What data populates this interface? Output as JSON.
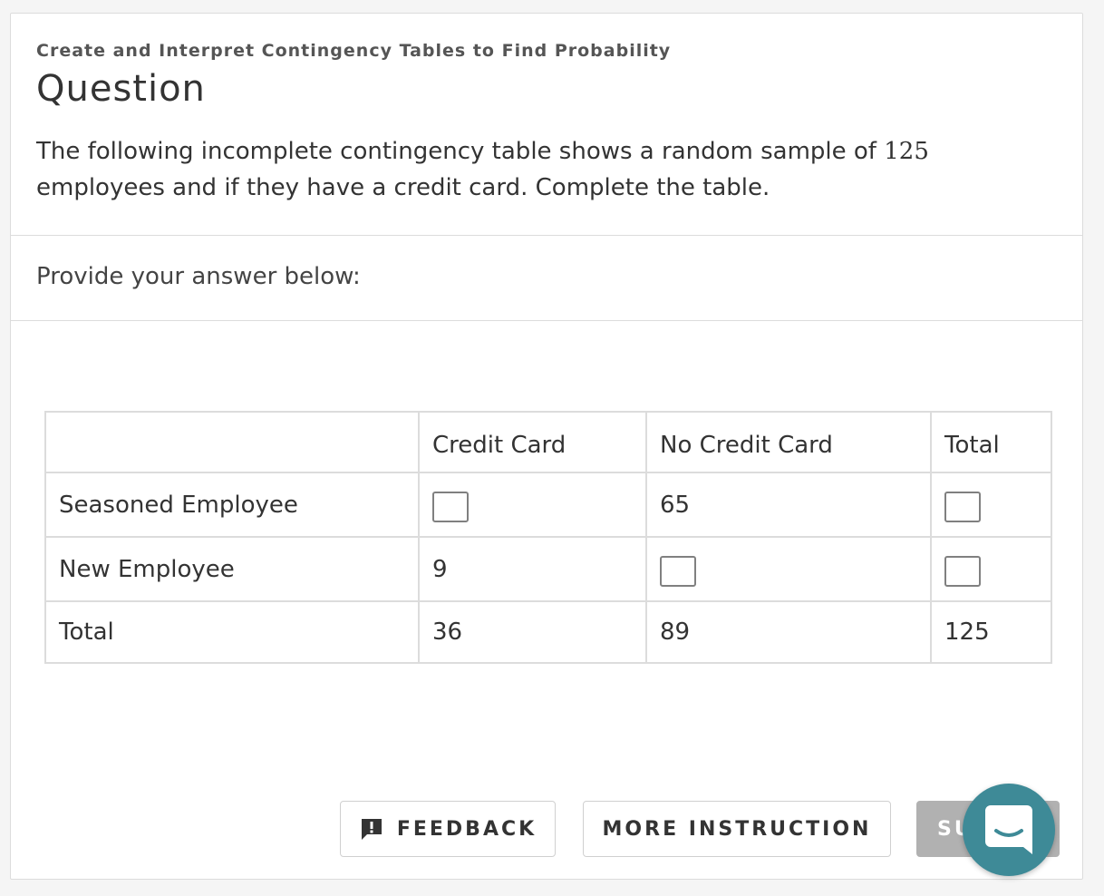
{
  "card": {
    "subtitle": "Create and Interpret Contingency Tables to Find Probability",
    "title": "Question",
    "question_part1": "The following incomplete contingency table shows a random sample of ",
    "question_number": "125",
    "question_part2": " employees and if they have a credit card. Complete the table.",
    "answer_label": "Provide your answer below:"
  },
  "table": {
    "headers": [
      "",
      "Credit Card",
      "No Credit Card",
      "Total"
    ],
    "rows": [
      {
        "label": "Seasoned Employee",
        "credit_card": "",
        "no_credit_card": "65",
        "total": ""
      },
      {
        "label": "New Employee",
        "credit_card": "9",
        "no_credit_card": "",
        "total": ""
      },
      {
        "label": "Total",
        "credit_card": "36",
        "no_credit_card": "89",
        "total": "125"
      }
    ]
  },
  "footer": {
    "feedback_label": "FEEDBACK",
    "more_instruction_label": "MORE INSTRUCTION",
    "submit_label": "SU"
  },
  "colors": {
    "submit_bg": "#b1b1b1",
    "chat_bg": "#3e8a97"
  },
  "icons": {
    "feedback": "feedback-icon",
    "chat": "chat-icon"
  }
}
